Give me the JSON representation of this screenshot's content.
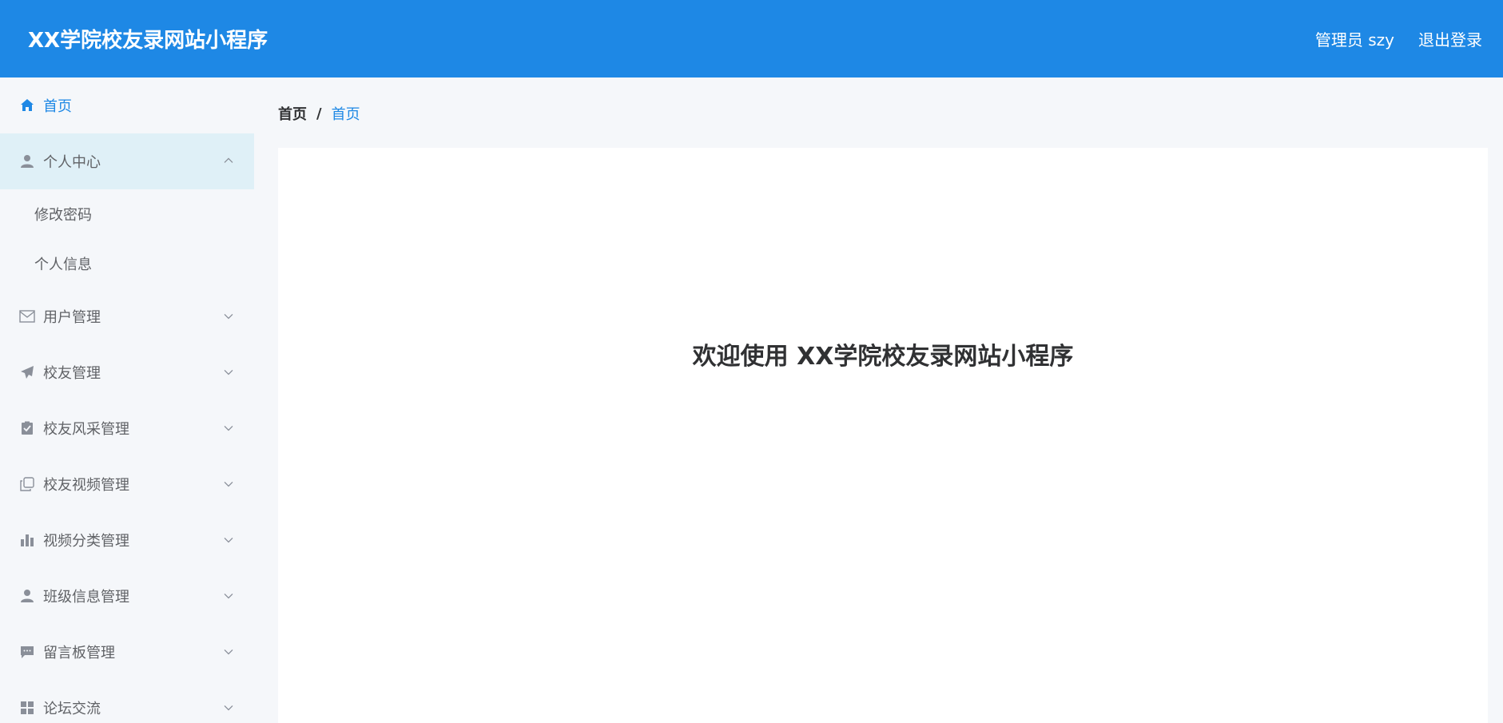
{
  "header": {
    "title": "XX学院校友录网站小程序",
    "user_label": "管理员 szy",
    "logout_label": "退出登录"
  },
  "sidebar": {
    "items": [
      {
        "label": "首页",
        "icon": "home-icon",
        "active": true
      },
      {
        "label": "个人中心",
        "icon": "user-icon",
        "expanded": true,
        "children": [
          {
            "label": "修改密码"
          },
          {
            "label": "个人信息"
          }
        ]
      },
      {
        "label": "用户管理",
        "icon": "mail-icon"
      },
      {
        "label": "校友管理",
        "icon": "paper-plane-icon"
      },
      {
        "label": "校友风采管理",
        "icon": "clipboard-check-icon"
      },
      {
        "label": "校友视频管理",
        "icon": "copy-icon"
      },
      {
        "label": "视频分类管理",
        "icon": "bar-chart-icon"
      },
      {
        "label": "班级信息管理",
        "icon": "user-icon"
      },
      {
        "label": "留言板管理",
        "icon": "comment-icon"
      },
      {
        "label": "论坛交流",
        "icon": "grid-icon"
      }
    ]
  },
  "breadcrumb": {
    "home": "首页",
    "separator": "/",
    "current": "首页"
  },
  "main": {
    "welcome_text": "欢迎使用 XX学院校友录网站小程序"
  },
  "colors": {
    "primary": "#1e88e5",
    "sidebar_bg": "#f5f7fa",
    "open_item_bg": "#dff0f7",
    "text": "#606266"
  }
}
